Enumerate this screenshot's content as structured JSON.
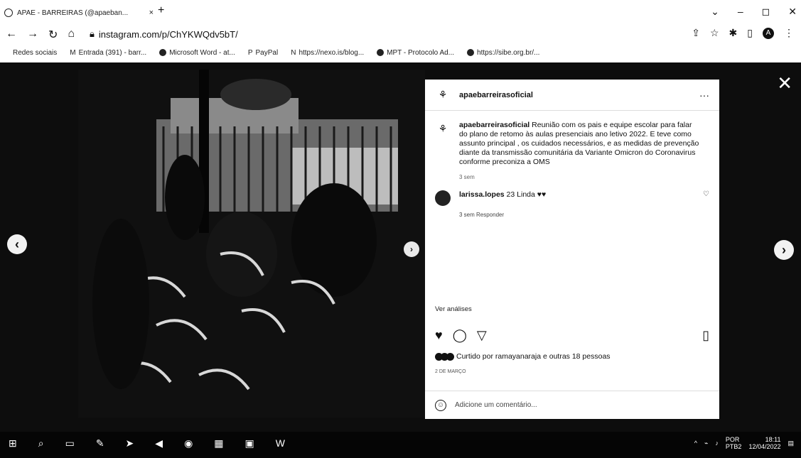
{
  "browser": {
    "tab_title": "APAE - BARREIRAS (@apaeban...",
    "url": "instagram.com/p/ChYKWQdv5bT/",
    "bookmarks": [
      "Redes sociais",
      "Entrada (391) - barr...",
      "Microsoft Word - at...",
      "PayPal",
      "https://nexo.is/blog...",
      "MPT - Protocolo Ad...",
      "https://sibe.org.br/..."
    ]
  },
  "post": {
    "username": "apaebarreirasoficial",
    "caption_user": "apaebarreirasoficial",
    "caption": "Reunião com os pais e equipe escolar para falar do plano de retomo às aulas presenciais ano letivo 2022. E teve como assunto principal , os cuidados necessários, e as medidas de prevenção diante da transmissão comunitária da Variante Omicron do Coronavirus conforme preconiza a OMS",
    "caption_time": "3 sem",
    "comment_user": "larissa.lopes",
    "comment_text": "23 Linda ♥♥",
    "comment_meta": "3 sem   Responder",
    "view_insights": "Ver análises",
    "likes_text": "Curtido por ramayanaraja e outras 18 pessoas",
    "post_date": "2 DE MARÇO",
    "add_comment_placeholder": "Adicione um comentário..."
  },
  "taskbar": {
    "lang1": "POR",
    "lang2": "PTB2",
    "time": "18:11",
    "date": "12/04/2022"
  }
}
